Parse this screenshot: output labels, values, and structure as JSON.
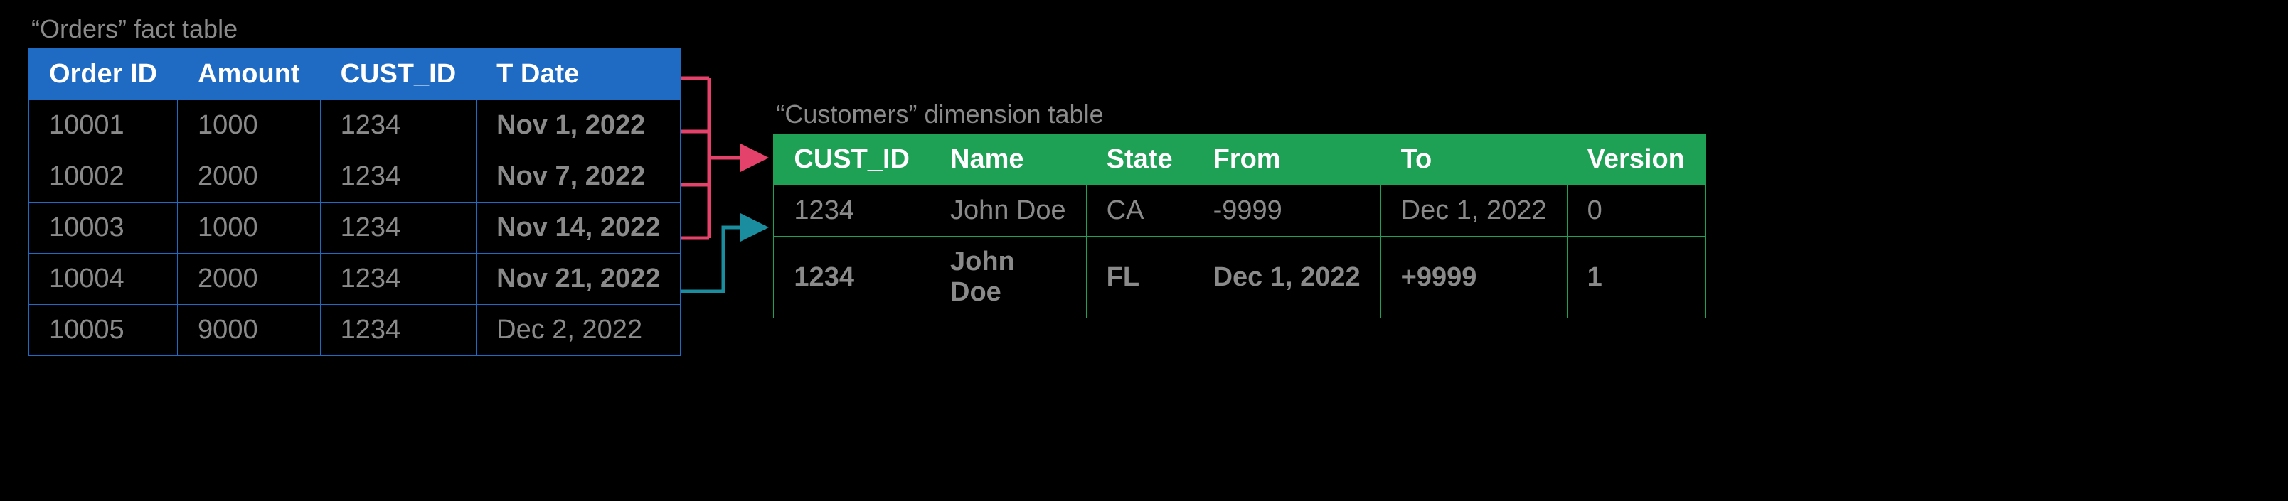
{
  "orders": {
    "caption": "“Orders” fact table",
    "headers": [
      "Order ID",
      "Amount",
      "CUST_ID",
      "T Date"
    ],
    "rows": [
      {
        "order_id": "10001",
        "amount": "1000",
        "cust_id": "1234",
        "tdate": "Nov 1, 2022",
        "date_bold": true
      },
      {
        "order_id": "10002",
        "amount": "2000",
        "cust_id": "1234",
        "tdate": "Nov 7, 2022",
        "date_bold": true
      },
      {
        "order_id": "10003",
        "amount": "1000",
        "cust_id": "1234",
        "tdate": "Nov 14, 2022",
        "date_bold": true
      },
      {
        "order_id": "10004",
        "amount": "2000",
        "cust_id": "1234",
        "tdate": "Nov 21, 2022",
        "date_bold": true
      },
      {
        "order_id": "10005",
        "amount": "9000",
        "cust_id": "1234",
        "tdate": "Dec 2, 2022",
        "date_bold": false
      }
    ]
  },
  "customers": {
    "caption": "“Customers” dimension table",
    "headers": [
      "CUST_ID",
      "Name",
      "State",
      "From",
      "To",
      "Version"
    ],
    "rows": [
      {
        "cust_id": "1234",
        "name": "John Doe",
        "state": "CA",
        "from": "-9999",
        "to": "Dec 1, 2022",
        "version": "0",
        "bold": false
      },
      {
        "cust_id": "1234",
        "name": "John Doe",
        "state": "FL",
        "from": "Dec 1, 2022",
        "to": "+9999",
        "version": "1",
        "bold": true
      }
    ]
  },
  "arrows": {
    "pink_color": "#e4426a",
    "teal_color": "#1a8d9e"
  }
}
